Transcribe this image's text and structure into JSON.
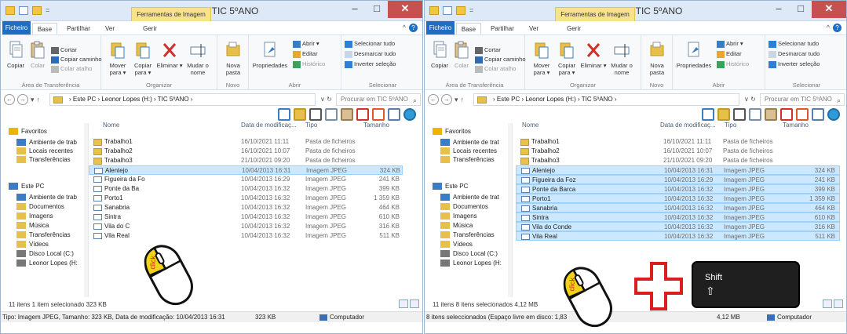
{
  "left": {
    "quick_access_more": "=",
    "context_tab": "Ferramentas de Imagem",
    "title": "TIC 5ºANO",
    "window_controls": {
      "minimize": "–",
      "maximize": "□",
      "close": "✕"
    },
    "tabs": [
      "Ficheiro",
      "Base",
      "Partilhar",
      "Ver",
      "Gerir"
    ],
    "ribbon_controls": "^",
    "help": "?",
    "ribbon": {
      "clipboard": {
        "label": "Área de Transferência",
        "copy": "Copiar",
        "paste": "Colar",
        "cut": "Cortar",
        "copy_path": "Copiar caminho",
        "paste_shortcut": "Colar atalho"
      },
      "organize": {
        "label": "Organizar",
        "move_to": "Mover para ▾",
        "copy_to": "Copiar para ▾",
        "delete": "Eliminar ▾",
        "rename": "Mudar o nome"
      },
      "new": {
        "label": "Novo",
        "new_folder": "Nova pasta"
      },
      "open": {
        "label": "Abrir",
        "properties": "Propriedades",
        "open": "Abrir ▾",
        "edit": "Editar",
        "history": "Histórico"
      },
      "select": {
        "label": "Selecionar",
        "select_all": "Selecionar tudo",
        "select_none": "Desmarcar tudo",
        "invert": "Inverter seleção"
      }
    },
    "nav": {
      "back": "←",
      "forward": "→",
      "recent": "▾",
      "up": "↑"
    },
    "address": "›  Este PC  ›  Leonor Lopes (H:)  ›  TIC 5ºANO  ›",
    "address_controls": "∨  ↻",
    "search_placeholder": "Procurar em TIC 5ºANO",
    "columns": {
      "name": "Nome",
      "date": "Data de modificaç...",
      "type": "Tipo",
      "size": "Tamanho"
    },
    "sidebar": [
      {
        "label": "Favoritos",
        "icon": "star-icon",
        "header": true
      },
      {
        "label": "Ambiente de trab",
        "icon": "desktop-icon"
      },
      {
        "label": "Locais recentes",
        "icon": "recent-places-icon"
      },
      {
        "label": "Transferências",
        "icon": "downloads-icon"
      },
      {
        "label": "Este PC",
        "icon": "computer-icon",
        "header": true
      },
      {
        "label": "Ambiente de trab",
        "icon": "desktop-icon"
      },
      {
        "label": "Documentos",
        "icon": "documents-icon"
      },
      {
        "label": "Imagens",
        "icon": "pictures-icon"
      },
      {
        "label": "Música",
        "icon": "music-icon"
      },
      {
        "label": "Transferências",
        "icon": "downloads-icon"
      },
      {
        "label": "Vídeos",
        "icon": "videos-icon"
      },
      {
        "label": "Disco Local (C:)",
        "icon": "local-disk-icon"
      },
      {
        "label": "Leonor Lopes (H:",
        "icon": "drive-icon"
      }
    ],
    "files": [
      {
        "name": "Trabalho1",
        "date": "16/10/2021 11:11",
        "type": "Pasta de ficheiros",
        "size": "",
        "kind": "folder",
        "selected": false
      },
      {
        "name": "Trabalho2",
        "date": "16/10/2021 10:07",
        "type": "Pasta de ficheiros",
        "size": "",
        "kind": "folder",
        "selected": false
      },
      {
        "name": "Trabalho3",
        "date": "21/10/2021 09:20",
        "type": "Pasta de ficheiros",
        "size": "",
        "kind": "folder",
        "selected": false
      },
      {
        "name": "Alentejo",
        "date": "10/04/2013 16:31",
        "type": "Imagem JPEG",
        "size": "324 KB",
        "kind": "image",
        "selected": true
      },
      {
        "name": "Figueira da Fo",
        "date": "10/04/2013 16:29",
        "type": "Imagem JPEG",
        "size": "241 KB",
        "kind": "image",
        "selected": false
      },
      {
        "name": "Ponte da Ba",
        "date": "10/04/2013 16:32",
        "type": "Imagem JPEG",
        "size": "399 KB",
        "kind": "image",
        "selected": false
      },
      {
        "name": "Porto1",
        "date": "10/04/2013 16:32",
        "type": "Imagem JPEG",
        "size": "1 359 KB",
        "kind": "image",
        "selected": false
      },
      {
        "name": "Sanabria",
        "date": "10/04/2013 16:32",
        "type": "Imagem JPEG",
        "size": "464 KB",
        "kind": "image",
        "selected": false
      },
      {
        "name": "Sintra",
        "date": "10/04/2013 16:32",
        "type": "Imagem JPEG",
        "size": "610 KB",
        "kind": "image",
        "selected": false
      },
      {
        "name": "Vila do C",
        "date": "10/04/2013 16:32",
        "type": "Imagem JPEG",
        "size": "316 KB",
        "kind": "image",
        "selected": false
      },
      {
        "name": "Vila Real",
        "date": "10/04/2013 16:32",
        "type": "Imagem JPEG",
        "size": "511 KB",
        "kind": "image",
        "selected": false
      }
    ],
    "status": "11 itens    1 item selecionado 323 KB",
    "details_bar": "Tipo: Imagem JPEG, Tamanho: 323 KB, Data de modificação: 10/04/2013 16:31",
    "details_size": "323 KB",
    "details_location": "Computador"
  },
  "right": {
    "quick_access_more": "=",
    "context_tab": "Ferramentas de Imagem",
    "title": "TIC 5ºANO",
    "window_controls": {
      "minimize": "–",
      "maximize": "□",
      "close": "✕"
    },
    "tabs": [
      "Ficheiro",
      "Base",
      "Partilhar",
      "Ver",
      "Gerir"
    ],
    "ribbon_controls": "^",
    "help": "?",
    "ribbon": {
      "clipboard": {
        "label": "Área de Transferência",
        "copy": "Copiar",
        "paste": "Colar",
        "cut": "Cortar",
        "copy_path": "Copiar caminho",
        "paste_shortcut": "Colar atalho"
      },
      "organize": {
        "label": "Organizar",
        "move_to": "Mover para ▾",
        "copy_to": "Copiar para ▾",
        "delete": "Eliminar ▾",
        "rename": "Mudar o nome"
      },
      "new": {
        "label": "Novo",
        "new_folder": "Nova pasta"
      },
      "open": {
        "label": "Abrir",
        "properties": "Propriedades",
        "open": "Abrir ▾",
        "edit": "Editar",
        "history": "Histórico"
      },
      "select": {
        "label": "Selecionar",
        "select_all": "Selecionar tudo",
        "select_none": "Desmarcar tudo",
        "invert": "Inverter seleção"
      }
    },
    "nav": {
      "back": "←",
      "forward": "→",
      "recent": "▾",
      "up": "↑"
    },
    "address": "›  Este PC  ›  Leonor Lopes (H:)  ›  TIC 5ºANO  ›",
    "address_controls": "∨  ↻",
    "search_placeholder": "Procurar em TIC 5ºANO",
    "columns": {
      "name": "Nome",
      "date": "Data de modificaç...",
      "type": "Tipo",
      "size": "Tamanho"
    },
    "sidebar": [
      {
        "label": "Favoritos",
        "icon": "star-icon",
        "header": true
      },
      {
        "label": "Ambiente de trat",
        "icon": "desktop-icon"
      },
      {
        "label": "Locais recentes",
        "icon": "recent-places-icon"
      },
      {
        "label": "Transferências",
        "icon": "downloads-icon"
      },
      {
        "label": "Este PC",
        "icon": "computer-icon",
        "header": true
      },
      {
        "label": "Ambiente de trat",
        "icon": "desktop-icon"
      },
      {
        "label": "Documentos",
        "icon": "documents-icon"
      },
      {
        "label": "Imagens",
        "icon": "pictures-icon"
      },
      {
        "label": "Música",
        "icon": "music-icon"
      },
      {
        "label": "Transferências",
        "icon": "downloads-icon"
      },
      {
        "label": "Vídeos",
        "icon": "videos-icon"
      },
      {
        "label": "Disco Local (C:)",
        "icon": "local-disk-icon"
      },
      {
        "label": "Leonor Lopes (H:",
        "icon": "drive-icon"
      }
    ],
    "files": [
      {
        "name": "Trabalho1",
        "date": "16/10/2021 11:11",
        "type": "Pasta de ficheiros",
        "size": "",
        "kind": "folder",
        "selected": false
      },
      {
        "name": "Trabalho2",
        "date": "16/10/2021 10:07",
        "type": "Pasta de ficheiros",
        "size": "",
        "kind": "folder",
        "selected": false
      },
      {
        "name": "Trabalho3",
        "date": "21/10/2021 09:20",
        "type": "Pasta de ficheiros",
        "size": "",
        "kind": "folder",
        "selected": false
      },
      {
        "name": "Alentejo",
        "date": "10/04/2013 16:31",
        "type": "Imagem JPEG",
        "size": "324 KB",
        "kind": "image",
        "selected": true
      },
      {
        "name": "Figueira da Foz",
        "date": "10/04/2013 16:29",
        "type": "Imagem JPEG",
        "size": "241 KB",
        "kind": "image",
        "selected": true
      },
      {
        "name": "Ponte da Barca",
        "date": "10/04/2013 16:32",
        "type": "Imagem JPEG",
        "size": "399 KB",
        "kind": "image",
        "selected": true
      },
      {
        "name": "Porto1",
        "date": "10/04/2013 16:32",
        "type": "Imagem JPEG",
        "size": "1 359 KB",
        "kind": "image",
        "selected": true
      },
      {
        "name": "Sanabria",
        "date": "10/04/2013 16:32",
        "type": "Imagem JPEG",
        "size": "464 KB",
        "kind": "image",
        "selected": true
      },
      {
        "name": "Sintra",
        "date": "10/04/2013 16:32",
        "type": "Imagem JPEG",
        "size": "610 KB",
        "kind": "image",
        "selected": true
      },
      {
        "name": "Vila do Conde",
        "date": "10/04/2013 16:32",
        "type": "Imagem JPEG",
        "size": "316 KB",
        "kind": "image",
        "selected": true
      },
      {
        "name": "Vila Real",
        "date": "10/04/2013 16:32",
        "type": "Imagem JPEG",
        "size": "511 KB",
        "kind": "image",
        "selected": true
      }
    ],
    "status": "11 itens    8 itens selecionados 4,12 MB",
    "details_bar": "8 itens seleccionados (Espaço livre em disco: 1,83",
    "details_size": "4,12 MB",
    "details_location": "Computador"
  },
  "overlays": {
    "click_label_left": "click",
    "click_label_right": "click",
    "shift_key_label": "Shift",
    "shift_key_arrow": "⇧",
    "plus_color": "#d81e1e",
    "mouse_highlight_color": "#f3d21a"
  }
}
